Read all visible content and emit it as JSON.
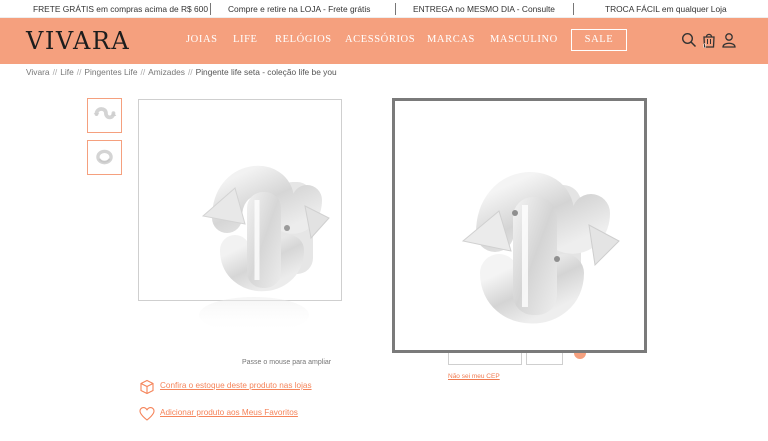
{
  "promo_bar": [
    "FRETE GRÁTIS em compras acima de R$ 600",
    "Compre e retire na LOJA - Frete grátis",
    "ENTREGA no MESMO DIA - Consulte",
    "TROCA FÁCIL em qualquer Loja"
  ],
  "header": {
    "logo": "VIVARA",
    "nav": [
      "JOIAS",
      "LIFE",
      "RELÓGIOS",
      "ACESSÓRIOS",
      "MARCAS",
      "MASCULINO"
    ],
    "sale": "SALE",
    "cart_count": "0",
    "icons": [
      "search-icon",
      "bag-icon",
      "user-icon"
    ]
  },
  "breadcrumb": [
    "Vivara",
    "Life",
    "Pingentes Life",
    "Amizades",
    "Pingente life seta - coleção life be you"
  ],
  "gallery": {
    "zoom_hint": "Passe o mouse para ampliar"
  },
  "shipping": {
    "cep_link": "Não sei meu CEP"
  },
  "actions": {
    "stock": "Confira o estoque deste produto nas lojas",
    "favorites": "Adicionar produto aos Meus Favoritos"
  },
  "colors": {
    "brand": "#f5a07e",
    "link": "#f5845a"
  }
}
